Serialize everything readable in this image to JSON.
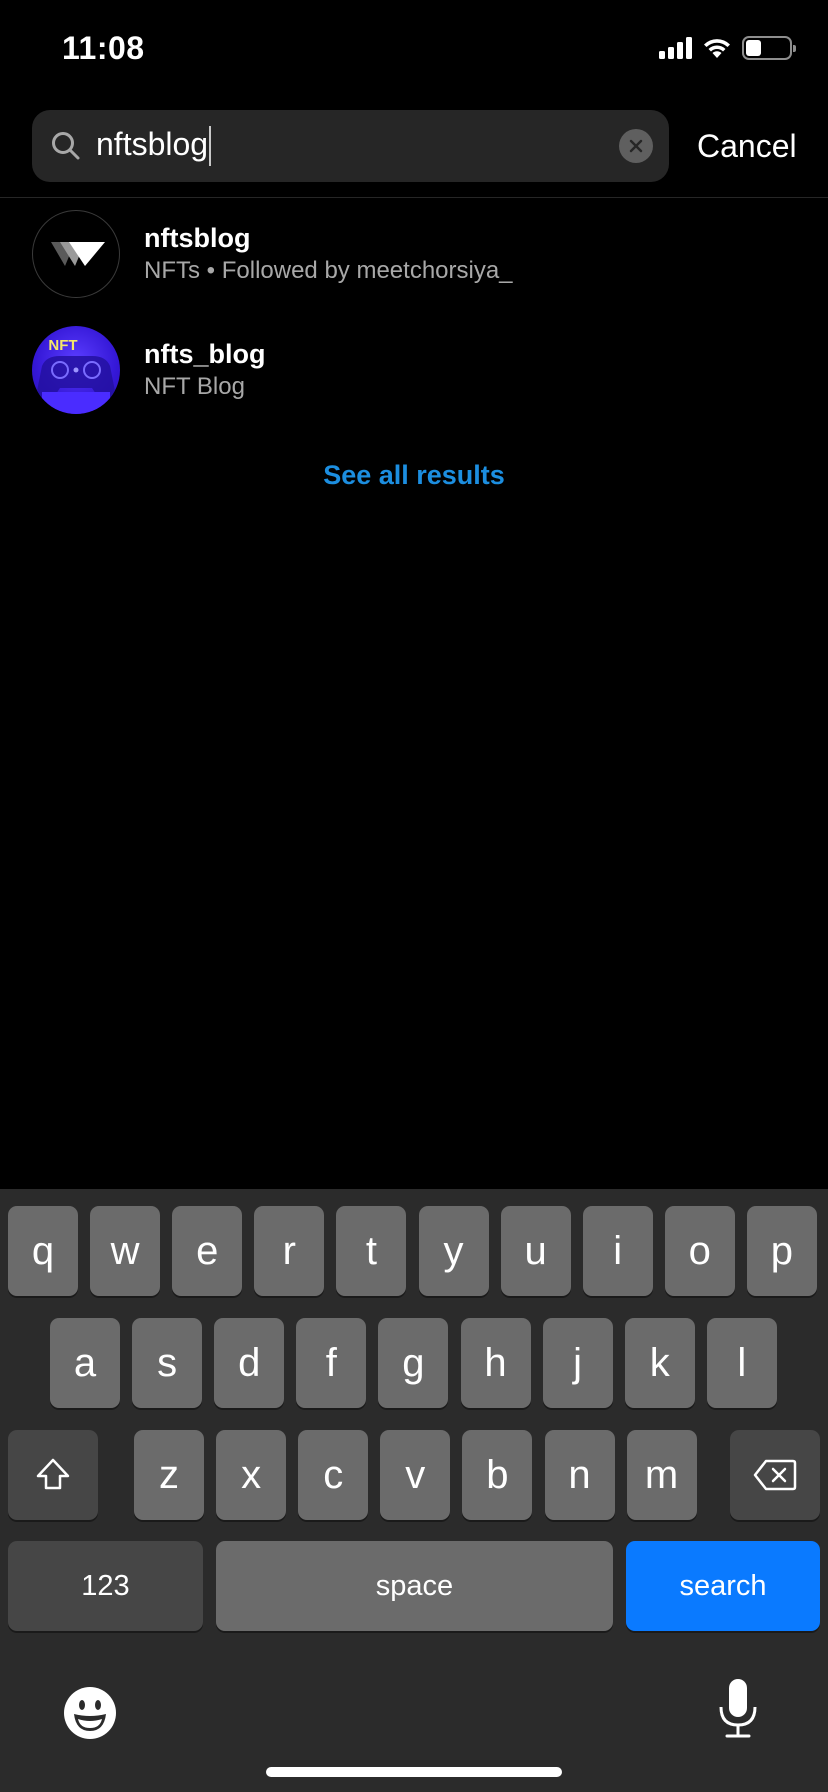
{
  "status_bar": {
    "time": "11:08",
    "signal_bars": 4,
    "wifi": true,
    "battery_level": 0.35
  },
  "search": {
    "value": "nftsblog",
    "clear_icon": "clear-circle-icon",
    "search_icon": "magnifier-icon",
    "cancel_label": "Cancel"
  },
  "results": [
    {
      "username": "nftsblog",
      "subtitle": "NFTs • Followed by meetchorsiya_",
      "avatar": "w-logo"
    },
    {
      "username": "nfts_blog",
      "subtitle": "NFT Blog",
      "avatar": "nft-gamepad",
      "avatar_text": "NFT"
    }
  ],
  "see_all_label": "See all results",
  "colors": {
    "link": "#1c8ee0",
    "search_key": "#0a7aff",
    "background": "#000000",
    "keyboard_bg": "#2b2b2b"
  },
  "keyboard": {
    "row1": [
      "q",
      "w",
      "e",
      "r",
      "t",
      "y",
      "u",
      "i",
      "o",
      "p"
    ],
    "row2": [
      "a",
      "s",
      "d",
      "f",
      "g",
      "h",
      "j",
      "k",
      "l"
    ],
    "row3": [
      "z",
      "x",
      "c",
      "v",
      "b",
      "n",
      "m"
    ],
    "numbers_label": "123",
    "space_label": "space",
    "search_label": "search"
  }
}
